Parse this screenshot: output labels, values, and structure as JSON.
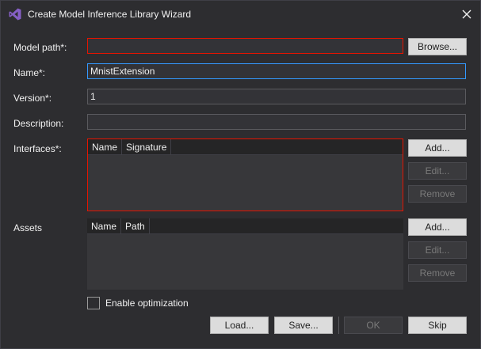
{
  "window": {
    "title": "Create Model Inference Library Wizard"
  },
  "fields": {
    "model_path": {
      "label": "Model path*:",
      "value": ""
    },
    "name": {
      "label": "Name*:",
      "value": "MnistExtension"
    },
    "version": {
      "label": "Version*:",
      "value": "1"
    },
    "description": {
      "label": "Description:",
      "value": ""
    }
  },
  "browse_label": "Browse...",
  "interfaces": {
    "label": "Interfaces*:",
    "columns": [
      "Name",
      "Signature"
    ],
    "add_label": "Add...",
    "edit_label": "Edit...",
    "remove_label": "Remove"
  },
  "assets": {
    "label": "Assets",
    "columns": [
      "Name",
      "Path"
    ],
    "add_label": "Add...",
    "edit_label": "Edit...",
    "remove_label": "Remove"
  },
  "enable_optimization_label": "Enable optimization",
  "footer": {
    "load_label": "Load...",
    "save_label": "Save...",
    "ok_label": "OK",
    "skip_label": "Skip"
  },
  "colors": {
    "error_border": "#e51400",
    "focus_border": "#3399ff",
    "vs_purple": "#865fc5"
  }
}
